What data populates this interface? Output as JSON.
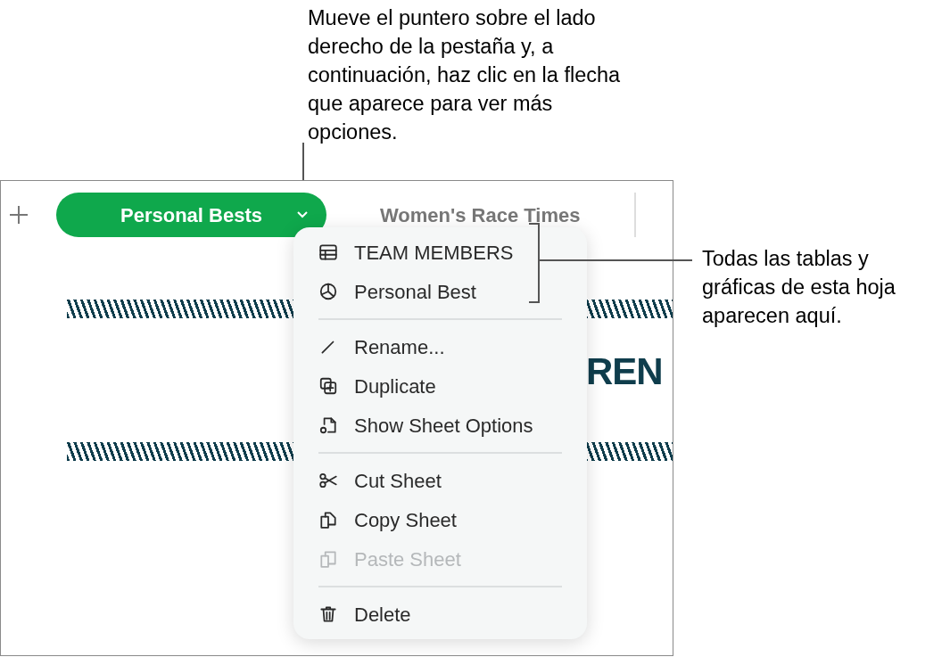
{
  "callout_top": "Mueve el puntero sobre el lado derecho de la pestaña y, a continuación, haz clic en la flecha que aparece para ver más opciones.",
  "callout_right": "Todas las tablas y gráficas de esta hoja aparecen aquí.",
  "sheet_tabs": [
    {
      "label": "Personal Bests",
      "selected": true
    },
    {
      "label": "Women's Race Times",
      "selected": false
    }
  ],
  "banner_fragment": "REN",
  "menu": {
    "sections": [
      [
        {
          "label": "TEAM MEMBERS",
          "kind": "table",
          "disabled": false
        },
        {
          "label": "Personal Best",
          "kind": "chart",
          "disabled": false
        }
      ],
      [
        {
          "label": "Rename...",
          "kind": "rename",
          "disabled": false
        },
        {
          "label": "Duplicate",
          "kind": "duplicate",
          "disabled": false
        },
        {
          "label": "Show Sheet Options",
          "kind": "options",
          "disabled": false
        }
      ],
      [
        {
          "label": "Cut Sheet",
          "kind": "cut",
          "disabled": false
        },
        {
          "label": "Copy Sheet",
          "kind": "copy",
          "disabled": false
        },
        {
          "label": "Paste Sheet",
          "kind": "paste",
          "disabled": true
        }
      ],
      [
        {
          "label": "Delete",
          "kind": "delete",
          "disabled": false
        }
      ]
    ]
  }
}
